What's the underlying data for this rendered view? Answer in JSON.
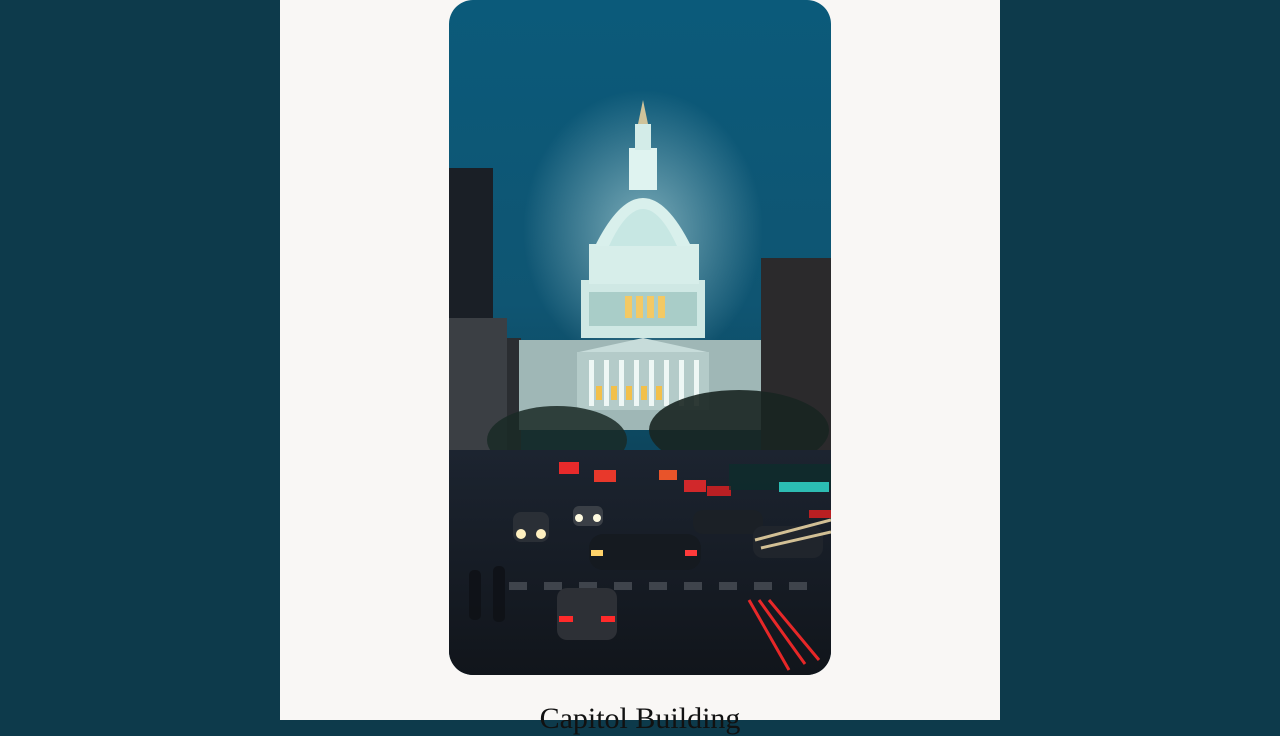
{
  "photo": {
    "subject_icon": "capitol-dome-icon",
    "sky_color": "#0f5572",
    "dome_color": "#bfe3df"
  },
  "caption": {
    "text": "Capitol Building"
  }
}
